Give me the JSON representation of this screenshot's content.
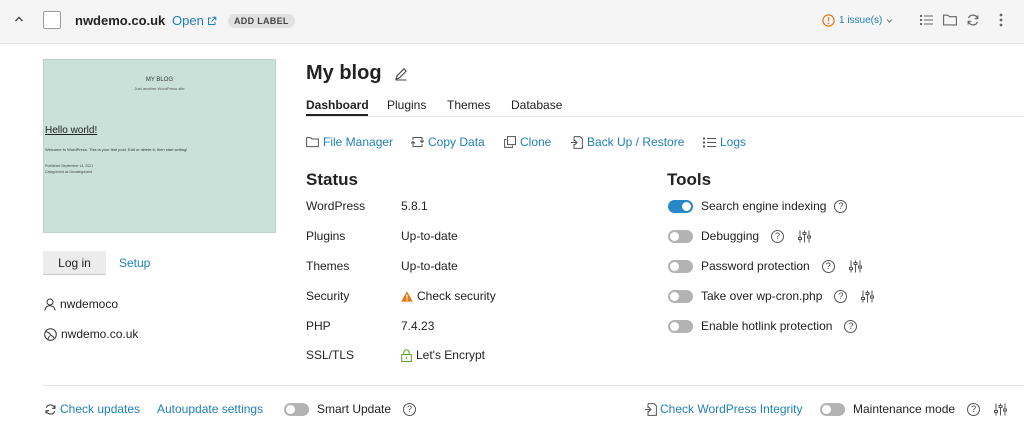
{
  "header": {
    "domain": "nwdemo.co.uk",
    "open_label": "Open",
    "add_label": "ADD LABEL",
    "issues_label": "1 issue(s)"
  },
  "preview": {
    "site_title": "MY BLOG",
    "tagline": "Just another WordPress site",
    "post_title": "Hello world!",
    "post_body": "Welcome to WordPress. This is your first post. Edit or delete it, then start writing!",
    "published": "Published September 14, 2021",
    "category": "Categorized as Uncategorized"
  },
  "sidebar": {
    "login_label": "Log in",
    "setup_label": "Setup",
    "user": "nwdemoco",
    "domain": "nwdemo.co.uk"
  },
  "main": {
    "title": "My blog",
    "tabs": [
      "Dashboard",
      "Plugins",
      "Themes",
      "Database"
    ],
    "actions": [
      "File Manager",
      "Copy Data",
      "Clone",
      "Back Up / Restore",
      "Logs"
    ]
  },
  "status": {
    "title": "Status",
    "rows": [
      {
        "label": "WordPress",
        "value": "5.8.1"
      },
      {
        "label": "Plugins",
        "value": "Up-to-date"
      },
      {
        "label": "Themes",
        "value": "Up-to-date"
      },
      {
        "label": "Security",
        "value": "Check security"
      },
      {
        "label": "PHP",
        "value": "7.4.23"
      },
      {
        "label": "SSL/TLS",
        "value": "Let's Encrypt"
      }
    ]
  },
  "tools": {
    "title": "Tools",
    "items": [
      {
        "label": "Search engine indexing",
        "enabled": true
      },
      {
        "label": "Debugging",
        "enabled": false
      },
      {
        "label": "Password protection",
        "enabled": false
      },
      {
        "label": "Take over wp-cron.php",
        "enabled": false
      },
      {
        "label": "Enable hotlink protection",
        "enabled": false
      }
    ]
  },
  "footer": {
    "check_updates": "Check updates",
    "autoupdate": "Autoupdate settings",
    "smart_update": "Smart Update",
    "check_integrity": "Check WordPress Integrity",
    "maintenance": "Maintenance mode"
  },
  "colors": {
    "link": "#1f7fb6",
    "toggle_on": "#2887c6",
    "warning": "#e07b1a",
    "ssl": "#5aa02c",
    "preview_bg": "#c9e1d8"
  }
}
